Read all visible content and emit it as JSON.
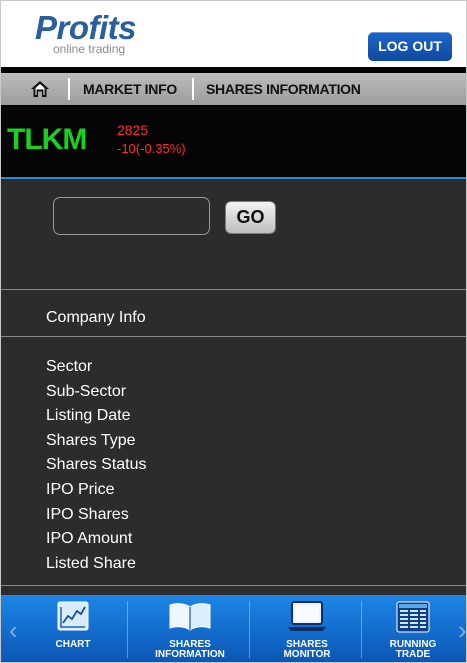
{
  "header": {
    "logo_main": "Profits",
    "logo_sub": "online trading",
    "logout_label": "LOG OUT"
  },
  "nav": {
    "items": [
      {
        "label": "MARKET INFO"
      },
      {
        "label": "SHARES INFORMATION"
      }
    ]
  },
  "ticker": {
    "code": "TLKM",
    "price": "2825",
    "change": "-10(-0.35%)",
    "code_color": "#18d21f",
    "change_color": "#ff2d2d"
  },
  "search": {
    "value": "",
    "placeholder": "",
    "go_label": "GO"
  },
  "company_info": {
    "title": "Company Info",
    "fields": [
      "Sector",
      "Sub-Sector",
      "Listing Date",
      "Shares Type",
      "Shares Status",
      "IPO Price",
      "IPO Shares",
      "IPO Amount",
      "Listed Share"
    ]
  },
  "tabbar": {
    "tabs": [
      {
        "label_line1": "CHART",
        "label_line2": "",
        "icon": "chart-icon"
      },
      {
        "label_line1": "SHARES",
        "label_line2": "INFORMATION",
        "icon": "book-icon"
      },
      {
        "label_line1": "SHARES",
        "label_line2": "MONITOR",
        "icon": "monitor-icon"
      },
      {
        "label_line1": "RUNNING",
        "label_line2": "TRADE",
        "icon": "running-trade-icon"
      }
    ]
  },
  "colors": {
    "accent": "#1d86e6",
    "brand": "#2a5f9e"
  }
}
